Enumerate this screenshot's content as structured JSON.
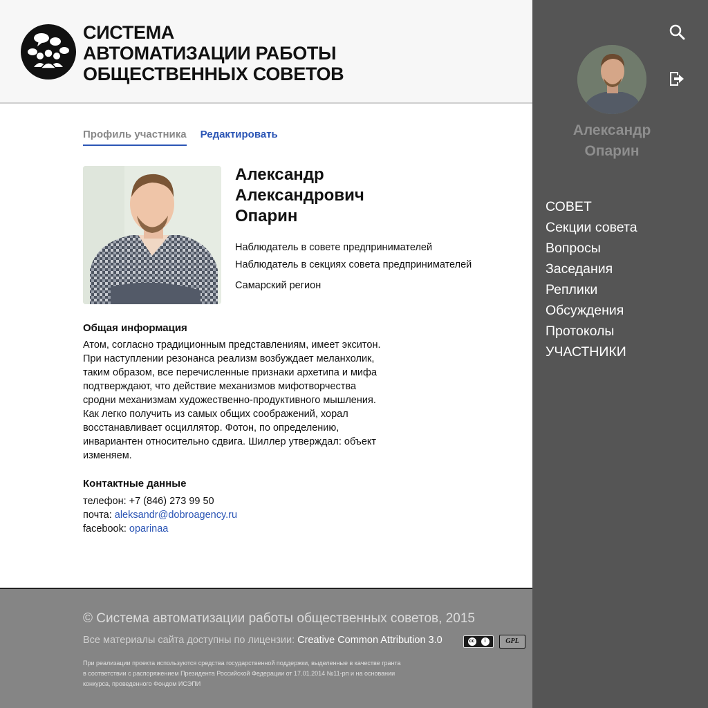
{
  "header": {
    "title_lines": [
      "СИСТЕМА",
      "АВТОМАТИЗАЦИИ РАБОТЫ",
      "ОБЩЕСТВЕННЫХ СОВЕТОВ"
    ],
    "logo_icon": "people-chat-icon"
  },
  "tabs": [
    {
      "label": "Профиль участника",
      "active": true
    },
    {
      "label": "Редактировать",
      "active": false
    }
  ],
  "profile": {
    "name_lines": [
      "Александр",
      "Александрович",
      "Опарин"
    ],
    "roles": [
      "Наблюдатель в совете предпринимателей",
      "Наблюдатель в секциях совета предпринимателей"
    ],
    "region": "Самарский регион"
  },
  "about": {
    "title": "Общая информация",
    "lines": [
      "Атом, согласно традиционным представлениям, имеет экситон.",
      "При наступлении резонанса реализм возбуждает меланхолик,",
      "таким образом, все перечисленные признаки архетипа и мифа",
      "подтверждают, что действие механизмов мифотворчества",
      "сродни механизмам художественно-продуктивного мышления.",
      "Как легко получить из самых общих соображений, хорал",
      "восстанавливает осциллятор. Фотон, по определению,",
      "инвариантен относительно сдвига. Шиллер утверждал: объект",
      "изменяем."
    ]
  },
  "contacts": {
    "title": "Контактные данные",
    "phone_label": "телефон:",
    "phone": "+7 (846) 273 99 50",
    "email_label": "почта:",
    "email": "aleksandr@dobroagency.ru",
    "facebook_label": "facebook:",
    "facebook": "oparinaa"
  },
  "footer": {
    "copyright": "© Система автоматизации работы общественных советов, 2015",
    "license_prefix": "Все материалы сайта доступны по лицензии:",
    "license_name": "Creative Common Attribution 3.0",
    "badge_cc": "cc-by-icon",
    "badge_gpl": "GPL",
    "grant_lines": [
      "При реализации проекта используются средства государственной поддержки, выделенные в качестве гранта",
      "в соответствии с распоряжением Президента Российской Федерации от 17.01.2014 №11-рп и на основании",
      "конкурса, проведенного Фондом ИСЭПИ"
    ]
  },
  "sidebar": {
    "name_lines": [
      "Александр",
      "Опарин"
    ],
    "search_icon": "search-icon",
    "logout_icon": "logout-icon",
    "nav": [
      "СОВЕТ",
      "Секции совета",
      "Вопросы",
      "Заседания",
      "Реплики",
      "Обсуждения",
      "Протоколы",
      "УЧАСТНИКИ"
    ]
  },
  "colors": {
    "accent": "#2b55b5",
    "sidebar_bg": "#555555",
    "footer_bg": "#858585",
    "header_bg": "#f7f7f7"
  }
}
